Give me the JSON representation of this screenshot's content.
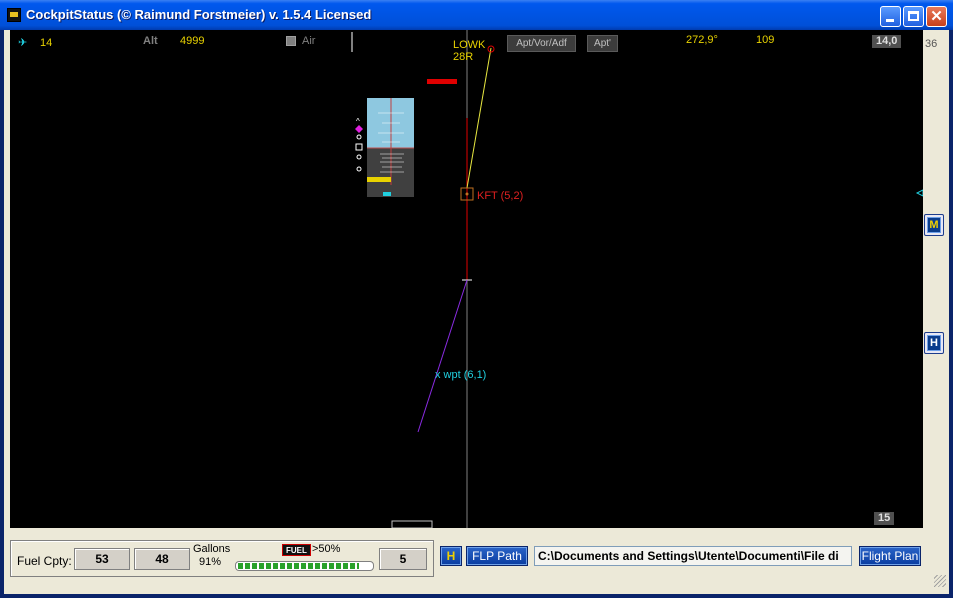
{
  "window": {
    "title": "CockpitStatus (© Raimund Forstmeier) v. 1.5.4 Licensed",
    "close_glyph": "✕"
  },
  "radar": {
    "top_left_value": "14",
    "alt_label": "Alt",
    "alt_value": "4999",
    "air_label": "Air",
    "airport_label": "LOWK",
    "runway_label": "28R",
    "btn_apt_vor_adf": "Apt/Vor/Adf",
    "btn_apt": "Apt'",
    "heading_value": "272,9°",
    "speed_value": "109",
    "range_box_top": "14,0",
    "edge_value_top": "36",
    "range_box_bottom": "15",
    "fix_label": "KFT (5,2)",
    "waypoint_label": "x wpt (6,1)",
    "colors": {
      "route_yellow": "#e8e840",
      "route_red": "#e00000",
      "route_purple": "#8a2be2",
      "label_cyan": "#20d0e0",
      "label_red": "#e02020",
      "text_yellow": "#e8d200"
    }
  },
  "side_buttons": {
    "m_label": "M",
    "h_label": "H"
  },
  "bottom": {
    "fuel_capacity_label": "Fuel Cpty:",
    "fuel_left": "53",
    "fuel_right": "48",
    "gallons_label": "Gallons",
    "gallons_pct": "91%",
    "fuel_badge": "FUEL",
    "fuel_threshold": ">50%",
    "fuel_bar_level": 0.91,
    "fuel_extra": "5",
    "h_button": "H",
    "flp_path_button": "FLP Path",
    "path_value": "C:\\Documents and Settings\\Utente\\Documenti\\File di",
    "flight_plan_button": "Flight Plan"
  }
}
